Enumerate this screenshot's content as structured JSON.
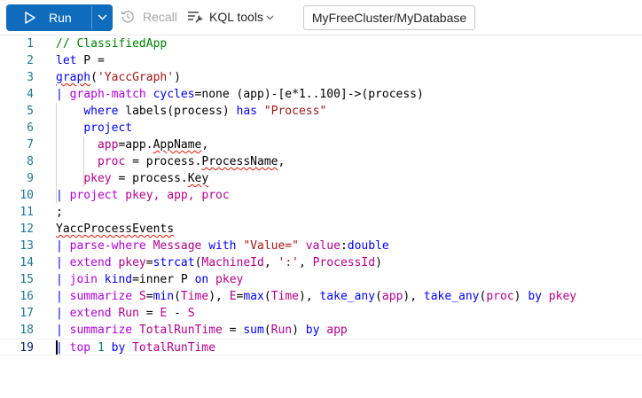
{
  "toolbar": {
    "run_label": "Run",
    "recall_label": "Recall",
    "kql_tools_label": "KQL tools",
    "database_path": "MyFreeCluster/MyDatabase"
  },
  "colors": {
    "run_button": "#0f6cbd",
    "line_number": "#237893",
    "comment": "#008000",
    "keyword": "#0000ff",
    "string": "#a31515",
    "operator": "#af00db",
    "error_squiggle": "#e51400"
  },
  "icons": {
    "run": "play-icon",
    "run_dropdown": "chevron-down-icon",
    "recall": "history-icon",
    "kql_tools": "tools-icon"
  },
  "editor": {
    "active_line": 19,
    "lines": [
      {
        "n": "1",
        "tokens": [
          {
            "t": "// ClassifiedApp",
            "c": "t-comment"
          }
        ]
      },
      {
        "n": "2",
        "tokens": [
          {
            "t": "let",
            "c": "t-kw"
          },
          {
            "t": " P =",
            "c": "t-id"
          }
        ]
      },
      {
        "n": "3",
        "tokens": [
          {
            "t": "graph",
            "c": "t-fn squig"
          },
          {
            "t": "(",
            "c": "t-id"
          },
          {
            "t": "'YaccGraph'",
            "c": "t-str"
          },
          {
            "t": ")",
            "c": "t-id"
          }
        ]
      },
      {
        "n": "4",
        "tokens": [
          {
            "t": "| ",
            "c": "t-pipe"
          },
          {
            "t": "graph-match",
            "c": "t-op"
          },
          {
            "t": " ",
            "c": "t-id"
          },
          {
            "t": "cycles",
            "c": "t-kw"
          },
          {
            "t": "=none (app)-[e*1..100]->(process)",
            "c": "t-id"
          }
        ]
      },
      {
        "n": "5",
        "tokens": [
          {
            "t": "    ",
            "c": "t-id"
          },
          {
            "t": "where",
            "c": "t-kw"
          },
          {
            "t": " labels(process) ",
            "c": "t-id"
          },
          {
            "t": "has",
            "c": "t-kw"
          },
          {
            "t": " ",
            "c": "t-id"
          },
          {
            "t": "\"Process\"",
            "c": "t-str"
          }
        ]
      },
      {
        "n": "6",
        "tokens": [
          {
            "t": "    ",
            "c": "t-id"
          },
          {
            "t": "project",
            "c": "t-kw"
          }
        ]
      },
      {
        "n": "7",
        "tokens": [
          {
            "t": "      ",
            "c": "t-id"
          },
          {
            "t": "app",
            "c": "t-col"
          },
          {
            "t": "=app.",
            "c": "t-id"
          },
          {
            "t": "AppName",
            "c": "t-id squig"
          },
          {
            "t": ",",
            "c": "t-id"
          }
        ]
      },
      {
        "n": "8",
        "tokens": [
          {
            "t": "      ",
            "c": "t-id"
          },
          {
            "t": "proc",
            "c": "t-col"
          },
          {
            "t": " = process.",
            "c": "t-id"
          },
          {
            "t": "ProcessName",
            "c": "t-id squig"
          },
          {
            "t": ",",
            "c": "t-id"
          }
        ]
      },
      {
        "n": "9",
        "tokens": [
          {
            "t": "    ",
            "c": "t-id"
          },
          {
            "t": "pkey",
            "c": "t-col"
          },
          {
            "t": " = process.",
            "c": "t-id"
          },
          {
            "t": "Key",
            "c": "t-id squig"
          }
        ]
      },
      {
        "n": "10",
        "tokens": [
          {
            "t": "| ",
            "c": "t-pipe"
          },
          {
            "t": "project",
            "c": "t-op"
          },
          {
            "t": " pkey, app, proc",
            "c": "t-col"
          }
        ]
      },
      {
        "n": "11",
        "tokens": [
          {
            "t": ";",
            "c": "t-id"
          }
        ]
      },
      {
        "n": "12",
        "tokens": [
          {
            "t": "YaccProcessEvents",
            "c": "t-id squig"
          }
        ]
      },
      {
        "n": "13",
        "tokens": [
          {
            "t": "| ",
            "c": "t-pipe"
          },
          {
            "t": "parse-where",
            "c": "t-op"
          },
          {
            "t": " Message ",
            "c": "t-col"
          },
          {
            "t": "with",
            "c": "t-kw"
          },
          {
            "t": " ",
            "c": "t-id"
          },
          {
            "t": "\"Value=\"",
            "c": "t-str"
          },
          {
            "t": " ",
            "c": "t-id"
          },
          {
            "t": "value",
            "c": "t-col"
          },
          {
            "t": ":",
            "c": "t-id"
          },
          {
            "t": "double",
            "c": "t-kw"
          }
        ]
      },
      {
        "n": "14",
        "tokens": [
          {
            "t": "| ",
            "c": "t-pipe"
          },
          {
            "t": "extend",
            "c": "t-op"
          },
          {
            "t": " ",
            "c": "t-id"
          },
          {
            "t": "pkey",
            "c": "t-col"
          },
          {
            "t": "=",
            "c": "t-id"
          },
          {
            "t": "strcat",
            "c": "t-fn"
          },
          {
            "t": "(",
            "c": "t-id"
          },
          {
            "t": "MachineId",
            "c": "t-col"
          },
          {
            "t": ", ",
            "c": "t-id"
          },
          {
            "t": "':'",
            "c": "t-str"
          },
          {
            "t": ", ",
            "c": "t-id"
          },
          {
            "t": "ProcessId",
            "c": "t-col"
          },
          {
            "t": ")",
            "c": "t-id"
          }
        ]
      },
      {
        "n": "15",
        "tokens": [
          {
            "t": "| ",
            "c": "t-pipe"
          },
          {
            "t": "join",
            "c": "t-op"
          },
          {
            "t": " ",
            "c": "t-id"
          },
          {
            "t": "kind",
            "c": "t-kw"
          },
          {
            "t": "=inner P ",
            "c": "t-id"
          },
          {
            "t": "on",
            "c": "t-kw"
          },
          {
            "t": " pkey",
            "c": "t-col"
          }
        ]
      },
      {
        "n": "16",
        "tokens": [
          {
            "t": "| ",
            "c": "t-pipe"
          },
          {
            "t": "summarize",
            "c": "t-op"
          },
          {
            "t": " ",
            "c": "t-id"
          },
          {
            "t": "S",
            "c": "t-col"
          },
          {
            "t": "=",
            "c": "t-id"
          },
          {
            "t": "min",
            "c": "t-fn"
          },
          {
            "t": "(",
            "c": "t-id"
          },
          {
            "t": "Time",
            "c": "t-col"
          },
          {
            "t": "), ",
            "c": "t-id"
          },
          {
            "t": "E",
            "c": "t-col"
          },
          {
            "t": "=",
            "c": "t-id"
          },
          {
            "t": "max",
            "c": "t-fn"
          },
          {
            "t": "(",
            "c": "t-id"
          },
          {
            "t": "Time",
            "c": "t-col"
          },
          {
            "t": "), ",
            "c": "t-id"
          },
          {
            "t": "take_any",
            "c": "t-fn"
          },
          {
            "t": "(",
            "c": "t-id"
          },
          {
            "t": "app",
            "c": "t-col"
          },
          {
            "t": "), ",
            "c": "t-id"
          },
          {
            "t": "take_any",
            "c": "t-fn"
          },
          {
            "t": "(",
            "c": "t-id"
          },
          {
            "t": "proc",
            "c": "t-col"
          },
          {
            "t": ") ",
            "c": "t-id"
          },
          {
            "t": "by",
            "c": "t-kw"
          },
          {
            "t": " pkey",
            "c": "t-col"
          }
        ]
      },
      {
        "n": "17",
        "tokens": [
          {
            "t": "| ",
            "c": "t-pipe"
          },
          {
            "t": "extend",
            "c": "t-op"
          },
          {
            "t": " ",
            "c": "t-id"
          },
          {
            "t": "Run",
            "c": "t-col"
          },
          {
            "t": " = ",
            "c": "t-id"
          },
          {
            "t": "E",
            "c": "t-col"
          },
          {
            "t": " - ",
            "c": "t-id"
          },
          {
            "t": "S",
            "c": "t-col"
          }
        ]
      },
      {
        "n": "18",
        "tokens": [
          {
            "t": "| ",
            "c": "t-pipe"
          },
          {
            "t": "summarize",
            "c": "t-op"
          },
          {
            "t": " ",
            "c": "t-id"
          },
          {
            "t": "TotalRunTime",
            "c": "t-col"
          },
          {
            "t": " = ",
            "c": "t-id"
          },
          {
            "t": "sum",
            "c": "t-fn"
          },
          {
            "t": "(",
            "c": "t-id"
          },
          {
            "t": "Run",
            "c": "t-col"
          },
          {
            "t": ") ",
            "c": "t-id"
          },
          {
            "t": "by",
            "c": "t-kw"
          },
          {
            "t": " app",
            "c": "t-col"
          }
        ]
      },
      {
        "n": "19",
        "tokens": [
          {
            "t": "| ",
            "c": "t-pipe"
          },
          {
            "t": "top",
            "c": "t-op"
          },
          {
            "t": " ",
            "c": "t-id"
          },
          {
            "t": "1",
            "c": "t-num"
          },
          {
            "t": " ",
            "c": "t-id"
          },
          {
            "t": "by",
            "c": "t-kw"
          },
          {
            "t": " TotalRunTime",
            "c": "t-col"
          }
        ]
      }
    ]
  }
}
